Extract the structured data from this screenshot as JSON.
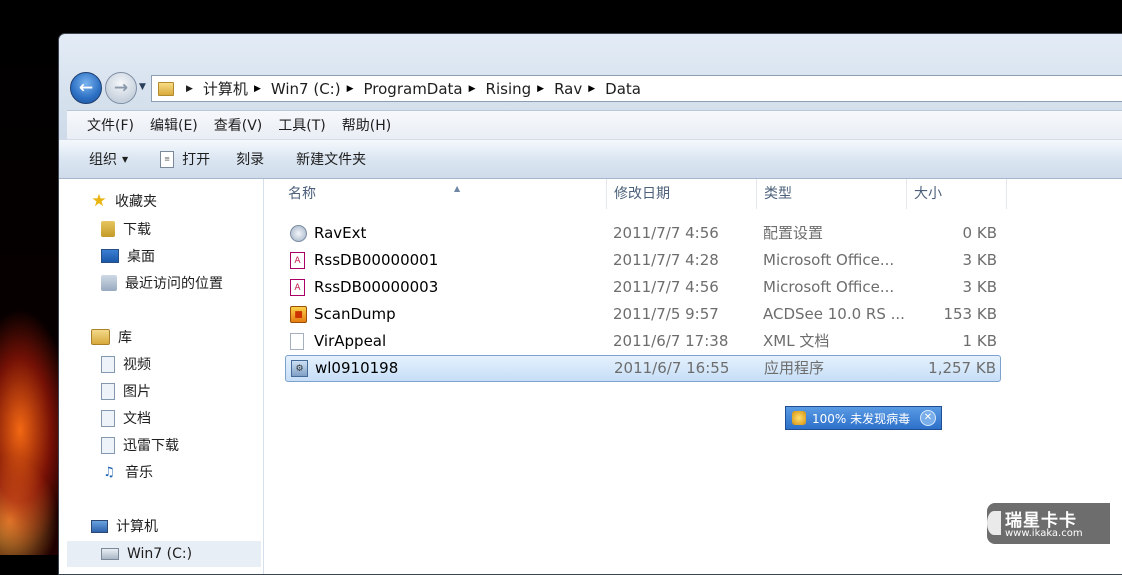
{
  "address": {
    "crumbs": [
      "计算机",
      "Win7 (C:)",
      "ProgramData",
      "Rising",
      "Rav",
      "Data"
    ]
  },
  "menu": {
    "items": [
      "文件(F)",
      "编辑(E)",
      "查看(V)",
      "工具(T)",
      "帮助(H)"
    ]
  },
  "toolbar": {
    "organize": "组织",
    "open": "打开",
    "burn": "刻录",
    "new_folder": "新建文件夹"
  },
  "navpane": {
    "favorites": "收藏夹",
    "downloads": "下载",
    "desktop": "桌面",
    "recent": "最近访问的位置",
    "libraries": "库",
    "videos": "视频",
    "pictures": "图片",
    "documents": "文档",
    "xunlei": "迅雷下载",
    "music": "音乐",
    "computer": "计算机",
    "drive": "Win7 (C:)"
  },
  "columns": {
    "name": "名称",
    "date": "修改日期",
    "type": "类型",
    "size": "大小"
  },
  "files": [
    {
      "name": "RavExt",
      "date": "2011/7/7 4:56",
      "type": "配置设置",
      "size": "0 KB",
      "icon": "config-file-icon"
    },
    {
      "name": "RssDB00000001",
      "date": "2011/7/7 4:28",
      "type": "Microsoft Office...",
      "size": "3 KB",
      "icon": "office-file-icon"
    },
    {
      "name": "RssDB00000003",
      "date": "2011/7/7 4:56",
      "type": "Microsoft Office...",
      "size": "3 KB",
      "icon": "office-file-icon"
    },
    {
      "name": "ScanDump",
      "date": "2011/7/5 9:57",
      "type": "ACDSee 10.0 RS ...",
      "size": "153 KB",
      "icon": "acdsee-file-icon"
    },
    {
      "name": "VirAppeal",
      "date": "2011/6/7 17:38",
      "type": "XML 文档",
      "size": "1 KB",
      "icon": "xml-file-icon"
    },
    {
      "name": "wl0910198",
      "date": "2011/6/7 16:55",
      "type": "应用程序",
      "size": "1,257 KB",
      "icon": "application-file-icon"
    }
  ],
  "scan_badge": {
    "text": "100%  未发现病毒"
  },
  "watermark": {
    "title": "瑞星卡卡",
    "url": "www.ikaka.com"
  }
}
